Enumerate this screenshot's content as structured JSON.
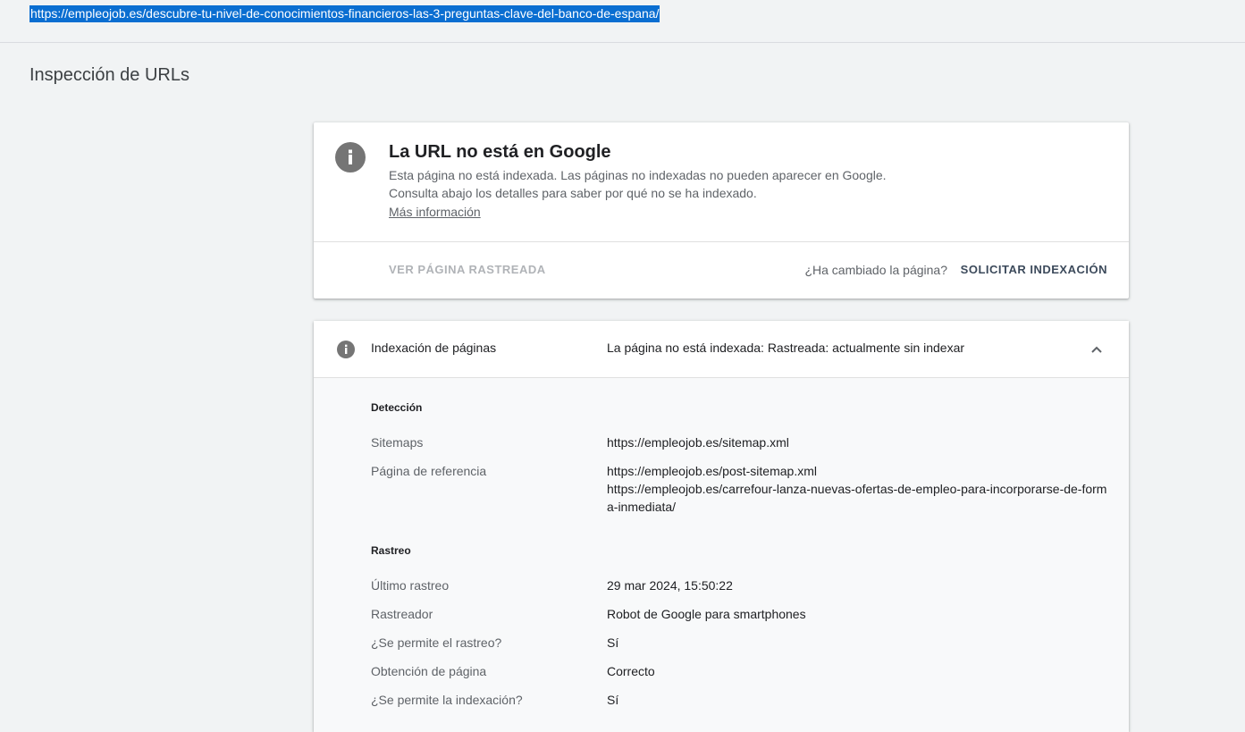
{
  "topbar": {
    "selected_url": "https://empleojob.es/descubre-tu-nivel-de-conocimientos-financieros-las-3-preguntas-clave-del-banco-de-espana/"
  },
  "page": {
    "title": "Inspección de URLs"
  },
  "status_card": {
    "title": "La URL no está en Google",
    "description": "Esta página no está indexada. Las páginas no indexadas no pueden aparecer en Google. Consulta abajo los detalles para saber por qué no se ha indexado.",
    "more_link": "Más información",
    "view_crawled_label": "VER PÁGINA RASTREADA",
    "changed_question": "¿Ha cambiado la página?",
    "request_index_label": "SOLICITAR INDEXACIÓN"
  },
  "index_card": {
    "label": "Indexación de páginas",
    "value": "La página no está indexada: Rastreada: actualmente sin indexar",
    "detection": {
      "heading": "Detección",
      "sitemaps_label": "Sitemaps",
      "sitemaps_value": "https://empleojob.es/sitemap.xml",
      "referrer_label": "Página de referencia",
      "referrer_value_1": "https://empleojob.es/post-sitemap.xml",
      "referrer_value_2": "https://empleojob.es/carrefour-lanza-nuevas-ofertas-de-empleo-para-incorporarse-de-forma-inmediata/"
    },
    "crawl": {
      "heading": "Rastreo",
      "last_crawl_label": "Último rastreo",
      "last_crawl_value": "29 mar 2024, 15:50:22",
      "crawler_label": "Rastreador",
      "crawler_value": "Robot de Google para smartphones",
      "crawl_allowed_label": "¿Se permite el rastreo?",
      "crawl_allowed_value": "Sí",
      "fetch_label": "Obtención de página",
      "fetch_value": "Correcto",
      "index_allowed_label": "¿Se permite la indexación?",
      "index_allowed_value": "Sí"
    }
  },
  "colors": {
    "selection": "#0a6ed1",
    "background": "#f1f3f4",
    "icon_gray": "#757575"
  },
  "icons": {
    "status": "info-icon",
    "index": "info-icon",
    "collapse": "chevron-up-icon"
  }
}
